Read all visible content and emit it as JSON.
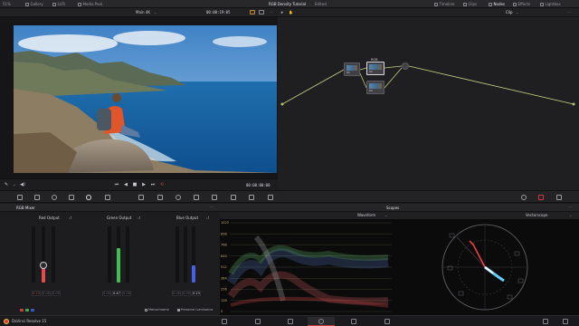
{
  "topbar": {
    "zoom": "51%",
    "menus": [
      "Gallery",
      "LUTs",
      "Media Pool"
    ],
    "project_title": "RGB Density Tutorial",
    "edited_label": "Edited",
    "right_menus": [
      "Timeline",
      "Clips",
      "Nodes",
      "Effects",
      "Lightbox"
    ]
  },
  "viewer": {
    "timeline_name": "Main 4K",
    "timecode_top": "00:00:19:05",
    "timecode_bottom": "00:00:00:00",
    "clip_label": "Clip"
  },
  "nodes": {
    "node1_label": "01",
    "node2_title": "RGB",
    "node2_label": "02",
    "node3_label": "03"
  },
  "mixer": {
    "title": "RGB Mixer",
    "groups": [
      {
        "label": "Red Output",
        "values": [
          "0.23",
          "0.00",
          "0.00"
        ],
        "main_color": "#e24b4b",
        "level": 0.23
      },
      {
        "label": "Green Output",
        "values": [
          "0.00",
          "0.47",
          "0.00"
        ],
        "main_color": "#3fbf4f",
        "level": 0.47
      },
      {
        "label": "Blue Output",
        "values": [
          "0.00",
          "0.00",
          "0.23"
        ],
        "main_color": "#4a5fe0",
        "level": 0.23
      }
    ],
    "monochrome_label": "Monochrome",
    "preserve_label": "Preserve Luminance"
  },
  "scopes": {
    "title": "Scopes",
    "waveform_label": "Waveform",
    "vectorscope_label": "Vectorscope",
    "wf_ticks": [
      "1023",
      "896",
      "768",
      "640",
      "512",
      "384",
      "256",
      "128",
      "0"
    ]
  },
  "footer": {
    "app_name": "DaVinci Resolve 15"
  },
  "colors": {
    "accent_red": "#c83a3a",
    "panel": "#1d1d20"
  }
}
